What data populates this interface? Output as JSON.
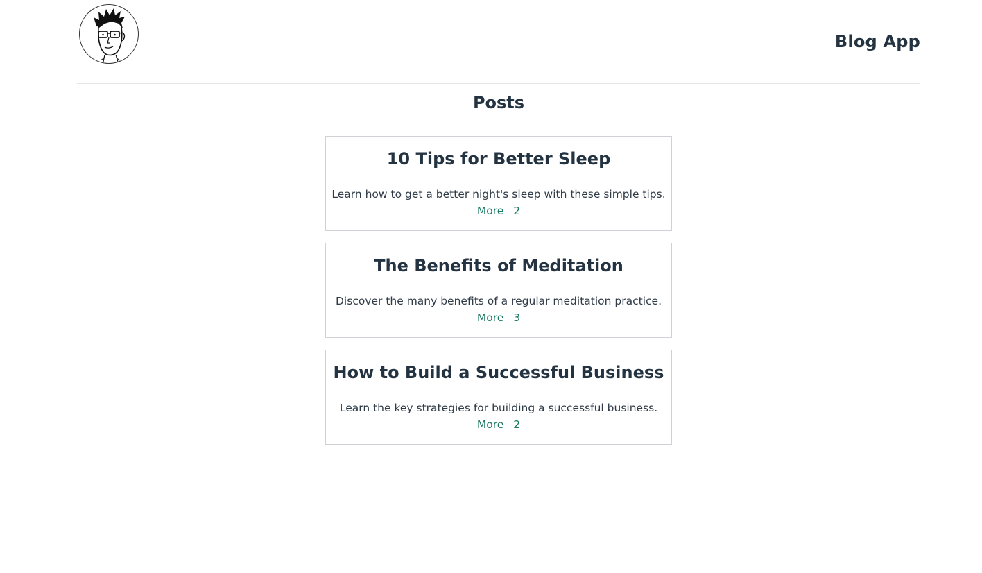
{
  "header": {
    "app_title": "Blog App",
    "avatar_icon": "cartoon-avatar-icon"
  },
  "main": {
    "heading": "Posts",
    "posts": [
      {
        "title": "10 Tips for Better Sleep",
        "description": "Learn how to get a better night's sleep with these simple tips.",
        "more_label": "More",
        "count": "2"
      },
      {
        "title": "The Benefits of Meditation",
        "description": "Discover the many benefits of a regular meditation practice.",
        "more_label": "More",
        "count": "3"
      },
      {
        "title": "How to Build a Successful Business",
        "description": "Learn the key strategies for building a successful business.",
        "more_label": "More",
        "count": "2"
      }
    ]
  },
  "colors": {
    "text": "#243342",
    "link": "#1a7a62",
    "border": "#cfd2d6"
  }
}
